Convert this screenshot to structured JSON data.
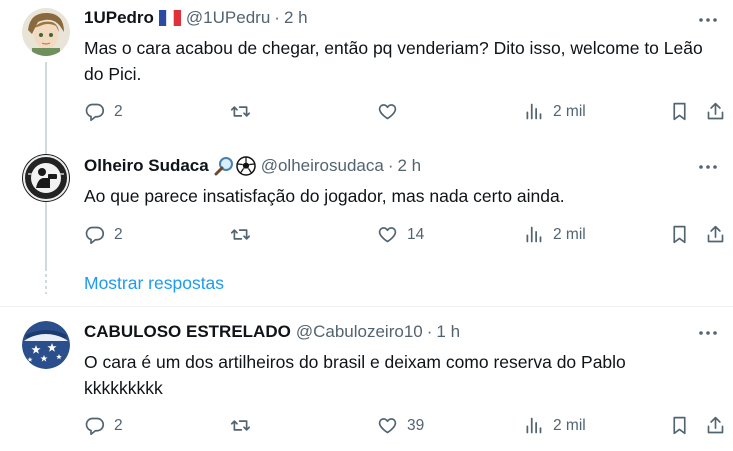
{
  "tweets": [
    {
      "name": "1UPedro",
      "handle": "@1UPedru",
      "time": "2 h",
      "flag_icon": "france-flag-icon",
      "text": "Mas o cara acabou de chegar, então pq venderiam? Dito isso, welcome to Leão do Pici.",
      "replies": "2",
      "reposts": "",
      "likes": "",
      "views": "2 mil"
    },
    {
      "name": "Olheiro Sudaca",
      "handle": "@olheirosudaca",
      "time": "2 h",
      "name_icons": [
        "magnifier-icon",
        "soccer-ball-icon"
      ],
      "text": "Ao que parece insatisfação do jogador, mas nada certo ainda.",
      "replies": "2",
      "reposts": "",
      "likes": "14",
      "views": "2 mil"
    },
    {
      "name": "CABULOSO ESTRELADO",
      "handle": "@Cabulozeiro10",
      "time": "1 h",
      "text": "O cara é um dos artilheiros do brasil e deixam como reserva do Pablo kkkkkkkkk",
      "replies": "2",
      "reposts": "",
      "likes": "39",
      "views": "2 mil"
    }
  ],
  "show_replies_label": "Mostrar respostas",
  "separator": "·",
  "colors": {
    "text": "#0f1419",
    "secondary": "#536471",
    "link": "#1d9bf0",
    "thread_line": "#cfd9de"
  }
}
